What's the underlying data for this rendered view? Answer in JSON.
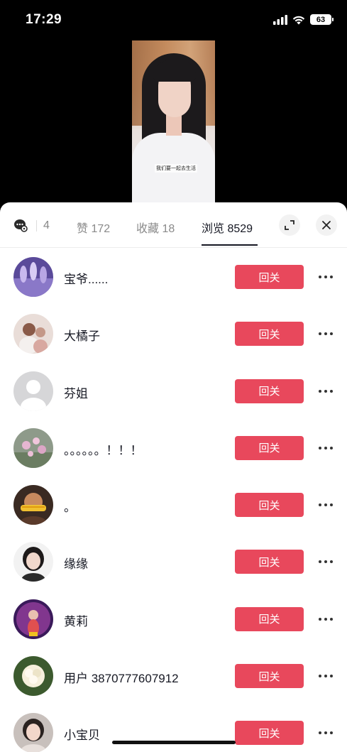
{
  "status_bar": {
    "time": "17:29",
    "battery": "63"
  },
  "video": {
    "caption": "我们要一起去生活"
  },
  "header": {
    "comment_count": "4",
    "tabs": [
      {
        "label": "赞 172",
        "active": false
      },
      {
        "label": "收藏 18",
        "active": false
      },
      {
        "label": "浏览 8529",
        "active": true
      }
    ]
  },
  "follow_label": "回关",
  "users": [
    {
      "name": "宝爷......",
      "avatar": "purple-dancers"
    },
    {
      "name": "大橘子",
      "avatar": "couple-photo"
    },
    {
      "name": "芬姐",
      "avatar": "default-avatar"
    },
    {
      "name": "。。。。。。！！！",
      "avatar": "pink-flowers"
    },
    {
      "name": "。",
      "avatar": "child-with-corn"
    },
    {
      "name": "缘缘",
      "avatar": "woman-portrait"
    },
    {
      "name": "黄莉",
      "avatar": "woman-on-stage"
    },
    {
      "name": "用户 3870777607912",
      "avatar": "white-flower"
    },
    {
      "name": "小宝贝",
      "avatar": "girl-selfie"
    }
  ],
  "colors": {
    "follow_button": "#e8485c",
    "text": "#161823",
    "muted": "#8a8a8a"
  }
}
